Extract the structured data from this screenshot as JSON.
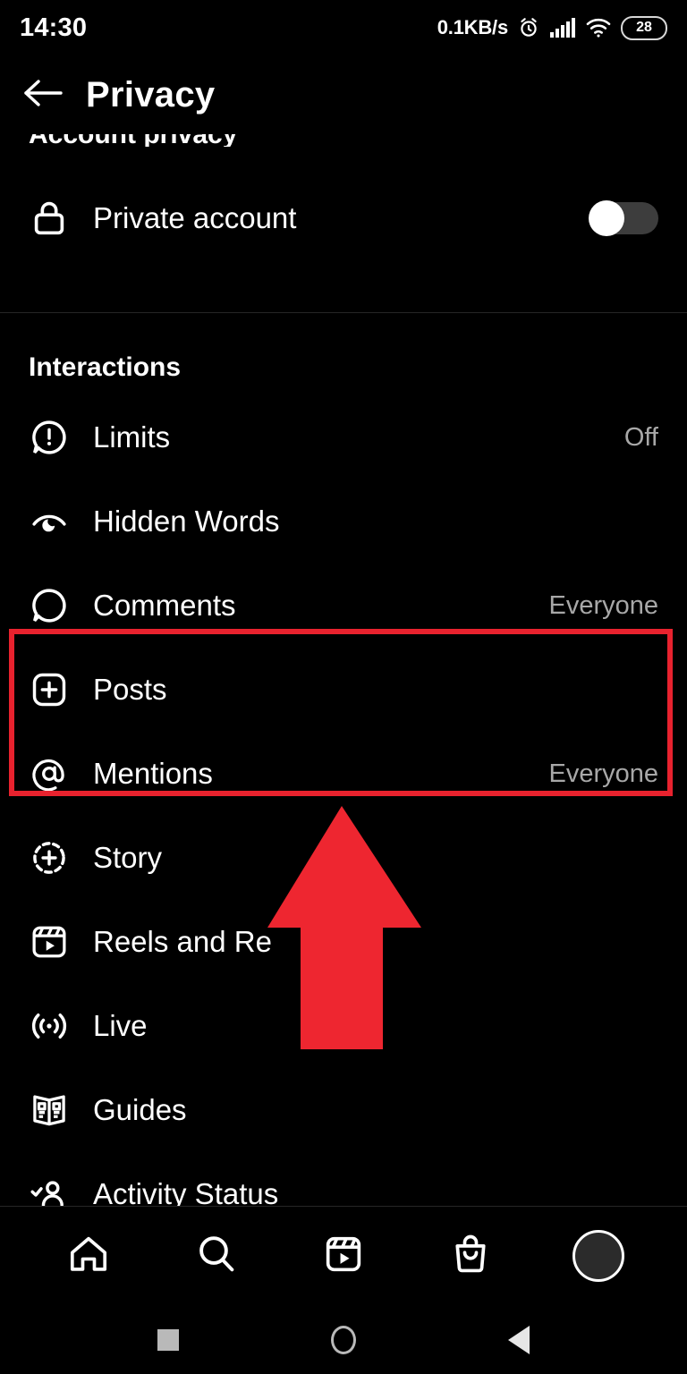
{
  "status_bar": {
    "time": "14:30",
    "network_speed": "0.1KB/s",
    "alarm_icon": "alarm-clock-icon",
    "signal_icon": "cellular-signal-icon",
    "wifi_icon": "wifi-icon",
    "battery_level": "28"
  },
  "header": {
    "back_icon": "back-arrow-icon",
    "title": "Privacy"
  },
  "sections": {
    "account_privacy": {
      "title": "Account privacy",
      "rows": [
        {
          "icon": "lock-icon",
          "label": "Private account",
          "control": "toggle",
          "toggle_on": false
        }
      ]
    },
    "interactions": {
      "title": "Interactions",
      "rows": [
        {
          "icon": "limits-icon",
          "label": "Limits",
          "value": "Off"
        },
        {
          "icon": "hidden-words-icon",
          "label": "Hidden Words",
          "value": ""
        },
        {
          "icon": "comment-icon",
          "label": "Comments",
          "value": "Everyone"
        },
        {
          "icon": "posts-plus-icon",
          "label": "Posts",
          "value": ""
        },
        {
          "icon": "mentions-at-icon",
          "label": "Mentions",
          "value": "Everyone"
        },
        {
          "icon": "story-plus-icon",
          "label": "Story",
          "value": ""
        },
        {
          "icon": "reels-icon",
          "label": "Reels and Re",
          "value": ""
        },
        {
          "icon": "live-broadcast-icon",
          "label": "Live",
          "value": ""
        },
        {
          "icon": "guides-book-icon",
          "label": "Guides",
          "value": ""
        },
        {
          "icon": "activity-status-icon",
          "label": "Activity Status",
          "value": ""
        }
      ]
    }
  },
  "annotations": {
    "highlight_color": "#e8222e",
    "arrow_color": "#ee2630",
    "highlight_targets": [
      "Posts",
      "Mentions"
    ]
  },
  "bottom_nav": {
    "items": [
      {
        "icon": "home-icon",
        "label": "Home"
      },
      {
        "icon": "search-icon",
        "label": "Search"
      },
      {
        "icon": "reels-nav-icon",
        "label": "Reels"
      },
      {
        "icon": "shop-bag-icon",
        "label": "Shop"
      },
      {
        "icon": "profile-avatar-icon",
        "label": "Profile"
      }
    ]
  },
  "system_nav": {
    "items": [
      {
        "icon": "recents-square-icon",
        "label": "Recents"
      },
      {
        "icon": "home-circle-icon",
        "label": "Home"
      },
      {
        "icon": "back-triangle-icon",
        "label": "Back"
      }
    ]
  }
}
